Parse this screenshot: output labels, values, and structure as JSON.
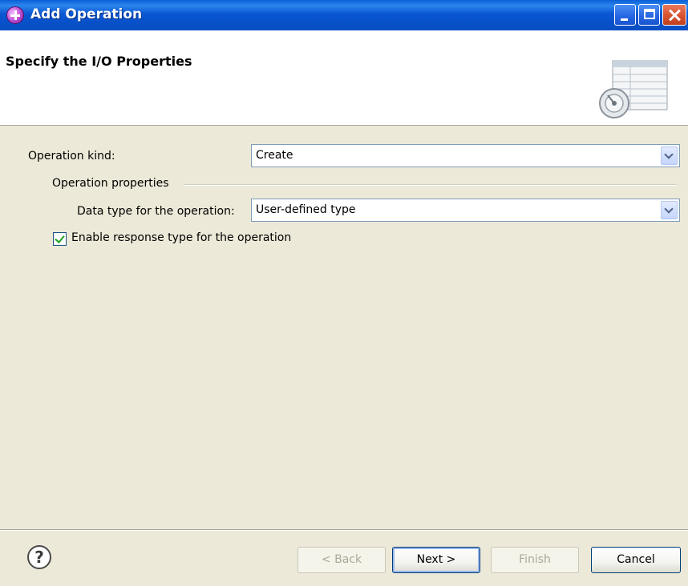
{
  "window": {
    "title": "Add Operation",
    "controls": [
      "minimize-icon",
      "maximize-icon",
      "close-icon"
    ]
  },
  "banner": {
    "title": "Specify the I/O Properties",
    "graphic": "table-properties-icon"
  },
  "form": {
    "operation_kind": {
      "label": "Operation kind:",
      "value": "Create"
    },
    "group": {
      "label": "Operation properties",
      "data_type": {
        "label": "Data type for the operation:",
        "value": "User-defined type"
      }
    },
    "enable_response": {
      "label": "Enable response type for the operation",
      "checked": true
    }
  },
  "footer": {
    "help_glyph": "?",
    "back_label": "< Back",
    "next_label": "Next >",
    "finish_label": "Finish",
    "cancel_label": "Cancel"
  },
  "colors": {
    "titlebar": "#0a57d3",
    "face": "#ece9d8",
    "banner": "#ffffff",
    "checkmark": "#21a121"
  }
}
